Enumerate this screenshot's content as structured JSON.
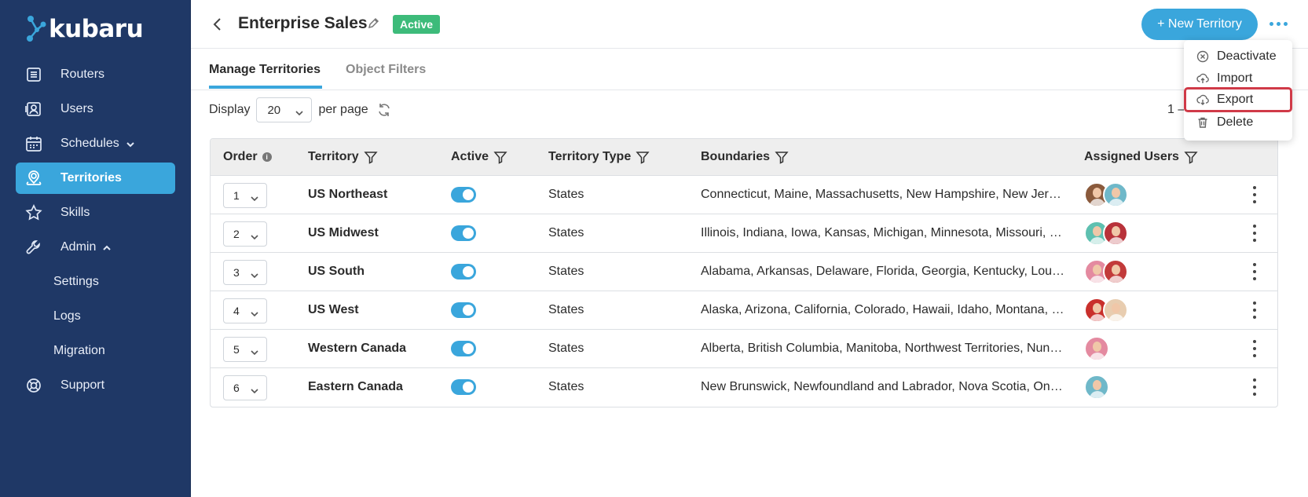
{
  "brand": {
    "name": "kubaru"
  },
  "sidebar": {
    "items": [
      {
        "label": "Routers",
        "icon": "list-icon"
      },
      {
        "label": "Users",
        "icon": "user-card-icon"
      },
      {
        "label": "Schedules",
        "icon": "calendar-icon",
        "expander": "chevron-down"
      },
      {
        "label": "Territories",
        "icon": "map-pin-icon",
        "active": true
      },
      {
        "label": "Skills",
        "icon": "star-icon"
      },
      {
        "label": "Admin",
        "icon": "wrench-icon",
        "expander": "chevron-up"
      },
      {
        "label": "Settings",
        "sub": true
      },
      {
        "label": "Logs",
        "sub": true
      },
      {
        "label": "Migration",
        "sub": true
      },
      {
        "label": "Support",
        "icon": "lifebuoy-icon"
      }
    ]
  },
  "header": {
    "title": "Enterprise Sales",
    "status": "Active",
    "new_button": "+ New Territory"
  },
  "tabs": [
    {
      "label": "Manage Territories",
      "active": true
    },
    {
      "label": "Object Filters",
      "active": false
    }
  ],
  "pager": {
    "display_label": "Display",
    "per_page_value": "20",
    "per_page_label": "per page",
    "range_text": "1 –"
  },
  "table": {
    "headers": {
      "order": "Order",
      "territory": "Territory",
      "active": "Active",
      "type": "Territory Type",
      "boundaries": "Boundaries",
      "users": "Assigned Users"
    },
    "rows": [
      {
        "order": "1",
        "name": "US Northeast",
        "type": "States",
        "boundaries": "Connecticut, Maine, Massachusetts, New Hampshire, New Jersey, New York, Pennsylvania, Rhode Island, Vermont",
        "avatars": [
          "#8a5a3c",
          "#6fb8c9"
        ]
      },
      {
        "order": "2",
        "name": "US Midwest",
        "type": "States",
        "boundaries": "Illinois, Indiana, Iowa, Kansas, Michigan, Minnesota, Missouri, Nebraska, North Dakota, Ohio, South Dakota, Wisconsin",
        "avatars": [
          "#5ec0b0",
          "#b8323a"
        ]
      },
      {
        "order": "3",
        "name": "US South",
        "type": "States",
        "boundaries": "Alabama, Arkansas, Delaware, Florida, Georgia, Kentucky, Louisiana, Maryland, Mississippi, North Carolina",
        "avatars": [
          "#e48aa0",
          "#c23a3a"
        ]
      },
      {
        "order": "4",
        "name": "US West",
        "type": "States",
        "boundaries": "Alaska, Arizona, California, Colorado, Hawaii, Idaho, Montana, Nevada, New Mexico, Oregon, Utah, Washington, Wyoming",
        "avatars": [
          "#c9302c",
          "#e8cdb0"
        ]
      },
      {
        "order": "5",
        "name": "Western Canada",
        "type": "States",
        "boundaries": "Alberta, British Columbia, Manitoba, Northwest Territories, Nunavut, Saskatchewan, Yukon",
        "avatars": [
          "#e48aa0"
        ]
      },
      {
        "order": "6",
        "name": "Eastern Canada",
        "type": "States",
        "boundaries": "New Brunswick, Newfoundland and Labrador, Nova Scotia, Ontario, Prince Edward Island, Quebec",
        "avatars": [
          "#6fb8c9"
        ]
      }
    ]
  },
  "menu": {
    "items": [
      {
        "label": "Deactivate",
        "icon": "circle-x-icon"
      },
      {
        "label": "Import",
        "icon": "cloud-upload-icon"
      },
      {
        "label": "Export",
        "icon": "cloud-download-icon",
        "highlighted": true
      },
      {
        "label": "Delete",
        "icon": "trash-icon"
      }
    ]
  },
  "colors": {
    "sidebar_bg": "#1f3866",
    "accent": "#3aa6dc",
    "active_badge": "#3dbb7a",
    "highlight_outline": "#d03a48"
  }
}
